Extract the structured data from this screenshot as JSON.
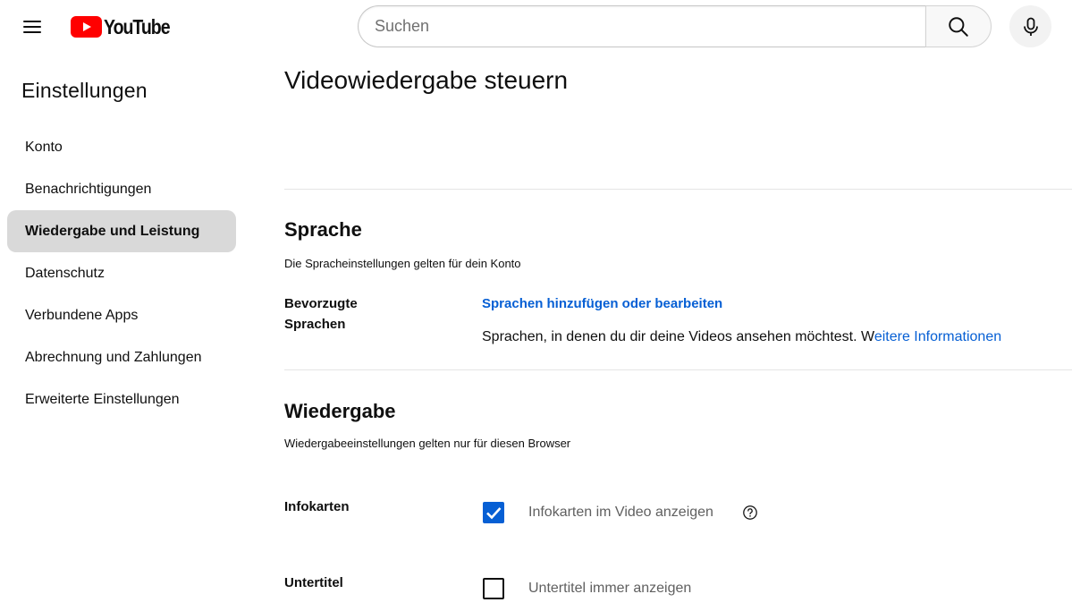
{
  "header": {
    "logo_text": "YouTube",
    "search_placeholder": "Suchen"
  },
  "sidebar": {
    "title": "Einstellungen",
    "items": [
      {
        "label": "Konto",
        "active": false
      },
      {
        "label": "Benachrichtigungen",
        "active": false
      },
      {
        "label": "Wiedergabe und Leistung",
        "active": true
      },
      {
        "label": "Datenschutz",
        "active": false
      },
      {
        "label": "Verbundene Apps",
        "active": false
      },
      {
        "label": "Abrechnung und Zahlungen",
        "active": false
      },
      {
        "label": "Erweiterte Einstellungen",
        "active": false
      }
    ]
  },
  "main": {
    "title": "Videowiedergabe steuern",
    "language": {
      "title": "Sprache",
      "description": "Die Spracheinstellungen gelten für dein Konto",
      "label_line1": "Bevorzugte",
      "label_line2": "Sprachen",
      "link": "Sprachen hinzufügen oder bearbeiten",
      "desc_text": "Sprachen, in denen du dir deine Videos ansehen möchtest. W",
      "desc_link": "eitere Informationen"
    },
    "playback": {
      "title": "Wiedergabe",
      "description": "Wiedergabeeinstellungen gelten nur für diesen Browser",
      "infocards": {
        "label": "Infokarten",
        "checkbox_label": "Infokarten im Video anzeigen",
        "checked": true
      },
      "subtitles": {
        "label": "Untertitel",
        "checkbox_label": "Untertitel immer anzeigen",
        "checked": false
      }
    }
  },
  "colors": {
    "accent": "#065fd4",
    "youtube_red": "#ff0000",
    "active_bg": "#d9d9d9",
    "text": "#0f0f0f",
    "muted": "#606060"
  },
  "icons": [
    "menu-icon",
    "youtube-logo-icon",
    "search-icon",
    "microphone-icon",
    "checkmark-icon",
    "help-icon"
  ]
}
